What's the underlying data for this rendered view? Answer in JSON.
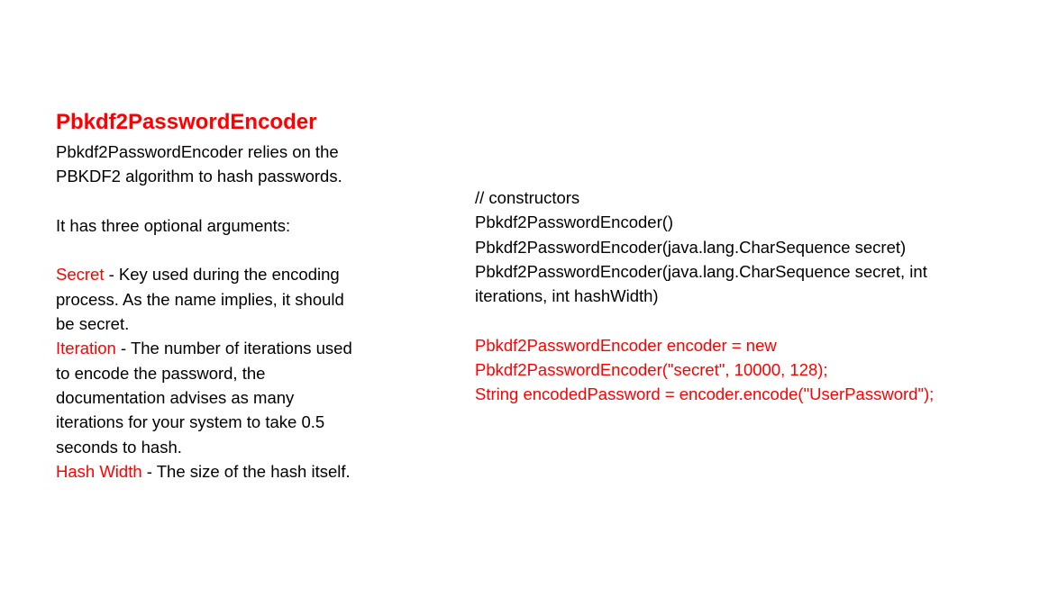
{
  "title": "Pbkdf2PasswordEncoder",
  "colors": {
    "accent": "#ff0000",
    "text": "#000000"
  },
  "left": {
    "intro": [
      "Pbkdf2PasswordEncoder relies on the",
      "PBKDF2 algorithm to hash passwords."
    ],
    "args_heading": "It has three optional arguments:",
    "args": [
      {
        "term": "Secret",
        "lines": [
          " - Key used during the encoding",
          "process. As the name implies, it should",
          "be secret."
        ]
      },
      {
        "term": "Iteration",
        "lines": [
          " - The number of iterations used",
          "to encode the password, the",
          "documentation advises as many",
          "iterations for your system to take 0.5",
          "seconds to hash."
        ]
      },
      {
        "term": "Hash Width",
        "lines": [
          " - The size of the hash itself."
        ]
      }
    ]
  },
  "right": {
    "constructors": [
      "// constructors",
      "Pbkdf2PasswordEncoder()",
      "Pbkdf2PasswordEncoder(java.lang.CharSequence secret)",
      "Pbkdf2PasswordEncoder(java.lang.CharSequence secret, int",
      "iterations, int hashWidth)"
    ],
    "example": [
      "Pbkdf2PasswordEncoder encoder = new",
      "Pbkdf2PasswordEncoder(\"secret\", 10000, 128);",
      "String encodedPassword = encoder.encode(\"UserPassword\");"
    ]
  }
}
